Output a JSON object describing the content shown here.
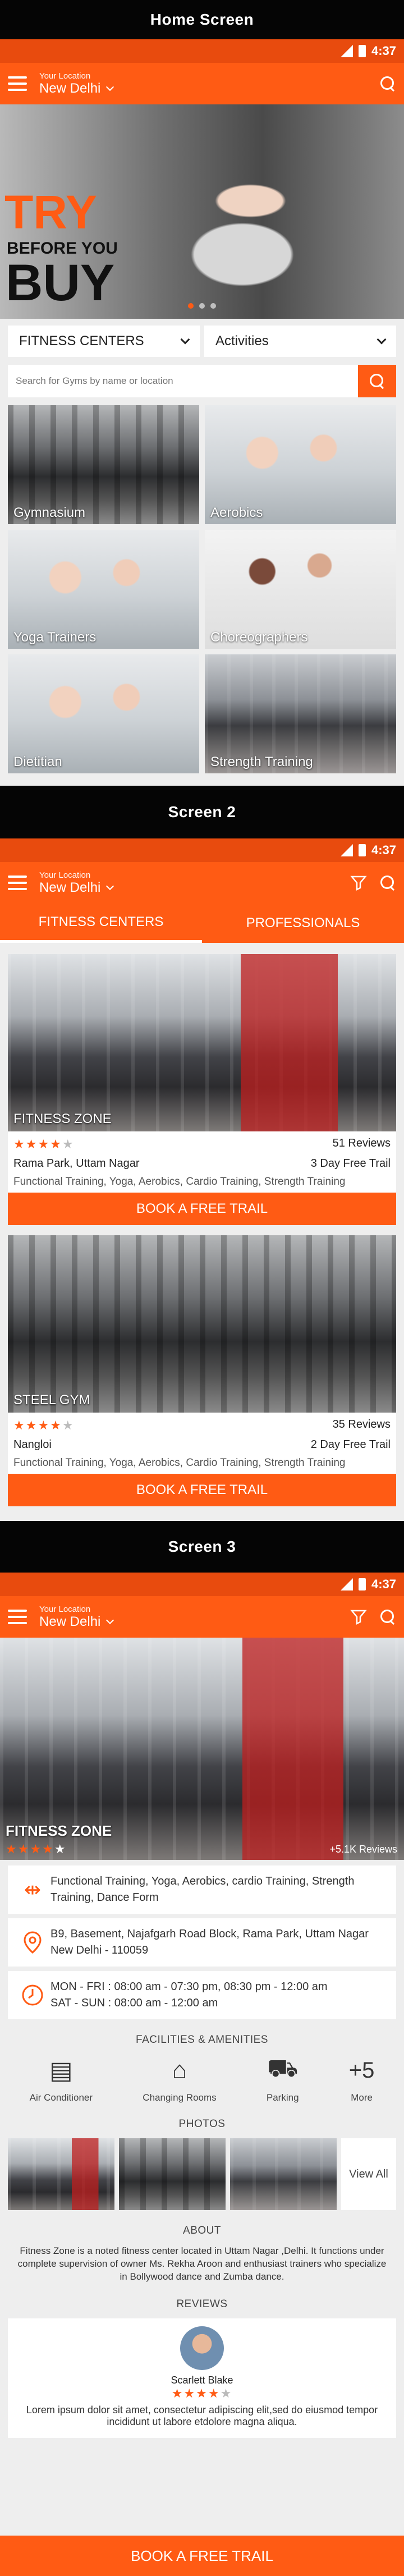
{
  "labels": {
    "home": "Home Screen",
    "screen2": "Screen 2",
    "screen3": "Screen 3"
  },
  "status": {
    "time": "4:37"
  },
  "location": {
    "caption": "Your Location",
    "city": "New Delhi"
  },
  "hero": {
    "try": "TRY",
    "before": "BEFORE YOU",
    "buy": "BUY"
  },
  "filters": {
    "centers": "FITNESS CENTERS",
    "activities": "Activities"
  },
  "search": {
    "placeholder": "Search for Gyms by name or location"
  },
  "categories": [
    "Gymnasium",
    "Aerobics",
    "Yoga Trainers",
    "Choreographers",
    "Dietitian",
    "Strength Training"
  ],
  "tabs": {
    "centers": "FITNESS CENTERS",
    "professionals": "PROFESSIONALS"
  },
  "gyms": [
    {
      "name": "FITNESS ZONE",
      "rating": 4,
      "reviews": "51 Reviews",
      "area": "Rama Park, Uttam Nagar",
      "trial": "3 Day Free Trail",
      "services": "Functional Training, Yoga, Aerobics,  Cardio Training, Strength Training",
      "book": "BOOK A FREE TRAIL"
    },
    {
      "name": "STEEL GYM",
      "rating": 4,
      "reviews": "35 Reviews",
      "area": "Nangloi",
      "trial": "2 Day Free Trail",
      "services": "Functional Training, Yoga, Aerobics,  Cardio Training, Strength Training",
      "book": "BOOK A FREE TRAIL"
    }
  ],
  "detail": {
    "name": "FITNESS ZONE",
    "rating": 4.5,
    "reviews": "+5.1K Reviews",
    "services": "Functional Training, Yoga, Aerobics, cardio Training, Strength Training, Dance Form",
    "address": "B9, Basement, Najafgarh Road Block, Rama Park, Uttam Nagar New Delhi - 110059",
    "hours_weekday": "MON - FRI : 08:00 am - 07:30 pm, 08:30 pm - 12:00 am",
    "hours_weekend": "SAT - SUN : 08:00 am - 12:00 am",
    "facilities_title": "FACILITIES & AMENITIES",
    "amenities": [
      "Air Conditioner",
      "Changing Rooms",
      "Parking",
      "More"
    ],
    "more_count": "+5",
    "photos_title": "PHOTOS",
    "view_all": "View All",
    "about_title": "ABOUT",
    "about": "Fitness Zone is a noted fitness center located in Uttam Nagar ,Delhi. It functions under complete supervision of owner Ms. Rekha Aroon and enthusiast trainers who specialize in Bollywood dance and Zumba dance.",
    "reviews_title": "REVIEWS",
    "reviewer": "Scarlett Blake",
    "reviewer_rating": 4.5,
    "review_text": "Lorem ipsum dolor sit amet, consectetur adipiscing elit,sed do eiusmod tempor incididunt ut labore etdolore magna aliqua.",
    "book": "BOOK A FREE TRAIL"
  },
  "colors": {
    "accent": "#ff5b14",
    "status": "#e84b0e"
  }
}
